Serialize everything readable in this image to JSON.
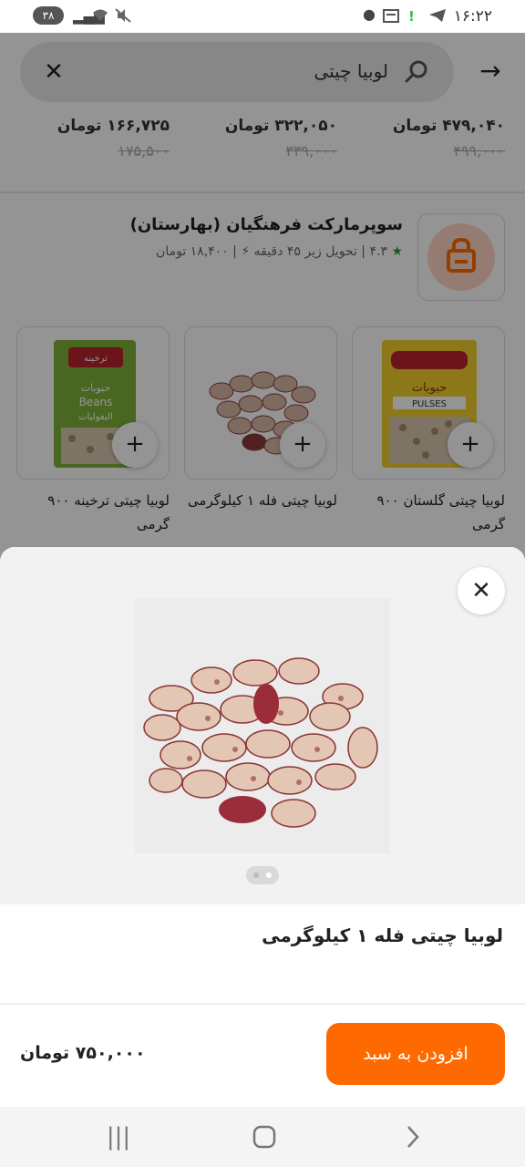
{
  "status_bar": {
    "time": "۱۶:۲۲",
    "battery": "۳۸",
    "icons": [
      "telegram-icon",
      "exclamation-icon",
      "calendar-icon",
      "dot-icon",
      "mute-icon",
      "wifi-icon",
      "signal-icon"
    ]
  },
  "search": {
    "query": "لوبیا چیتی",
    "back_icon": "arrow-right-icon",
    "clear_icon": "close-icon"
  },
  "price_row": [
    {
      "price": "۴۷۹,۰۴۰ تومان",
      "old_price": "۴۹۹,۰۰۰"
    },
    {
      "price": "۳۲۲,۰۵۰ تومان",
      "old_price": "۳۳۹,۰۰۰"
    },
    {
      "price": "۱۶۶,۷۲۵ تومان",
      "old_price": "۱۷۵,۵۰۰"
    }
  ],
  "store": {
    "name": "سوپرمارکت فرهنگیان (بهارستان)",
    "rating": "۴.۳",
    "delivery": "تحویل زیر ۴۵ دقیقه",
    "delivery_fee": "۱۸,۴۰۰ تومان"
  },
  "products": [
    {
      "title": "لوبیا چیتی گلستان ۹۰۰ گرمی",
      "package_text": "حبوبات",
      "package_sub": "PULSES",
      "brand": "گلستان"
    },
    {
      "title": "لوبیا چیتی فله ۱ کیلوگرمی"
    },
    {
      "title": "لوبیا چیتی ترخینه ۹۰۰ گرمی",
      "package_text": "حبوبات",
      "package_sub": "Beans",
      "package_sub2": "البقولیات",
      "brand": "ترخینه"
    }
  ],
  "sheet": {
    "title": "لوبیا چیتی فله ۱ کیلوگرمی",
    "price": "۷۵۰,۰۰۰ تومان",
    "add_button": "افزودن به سبد",
    "close_icon": "close-icon",
    "image_index": 1,
    "image_count": 2
  },
  "colors": {
    "accent": "#ff6a00",
    "accent_light": "#ffd6c4",
    "rating_star": "#2e9a4a",
    "page_dim": "rgba(0,0,0,0.42)"
  },
  "nav": {
    "recents_icon": "recents-icon",
    "home_icon": "home-icon",
    "back_icon": "back-chevron-icon"
  }
}
